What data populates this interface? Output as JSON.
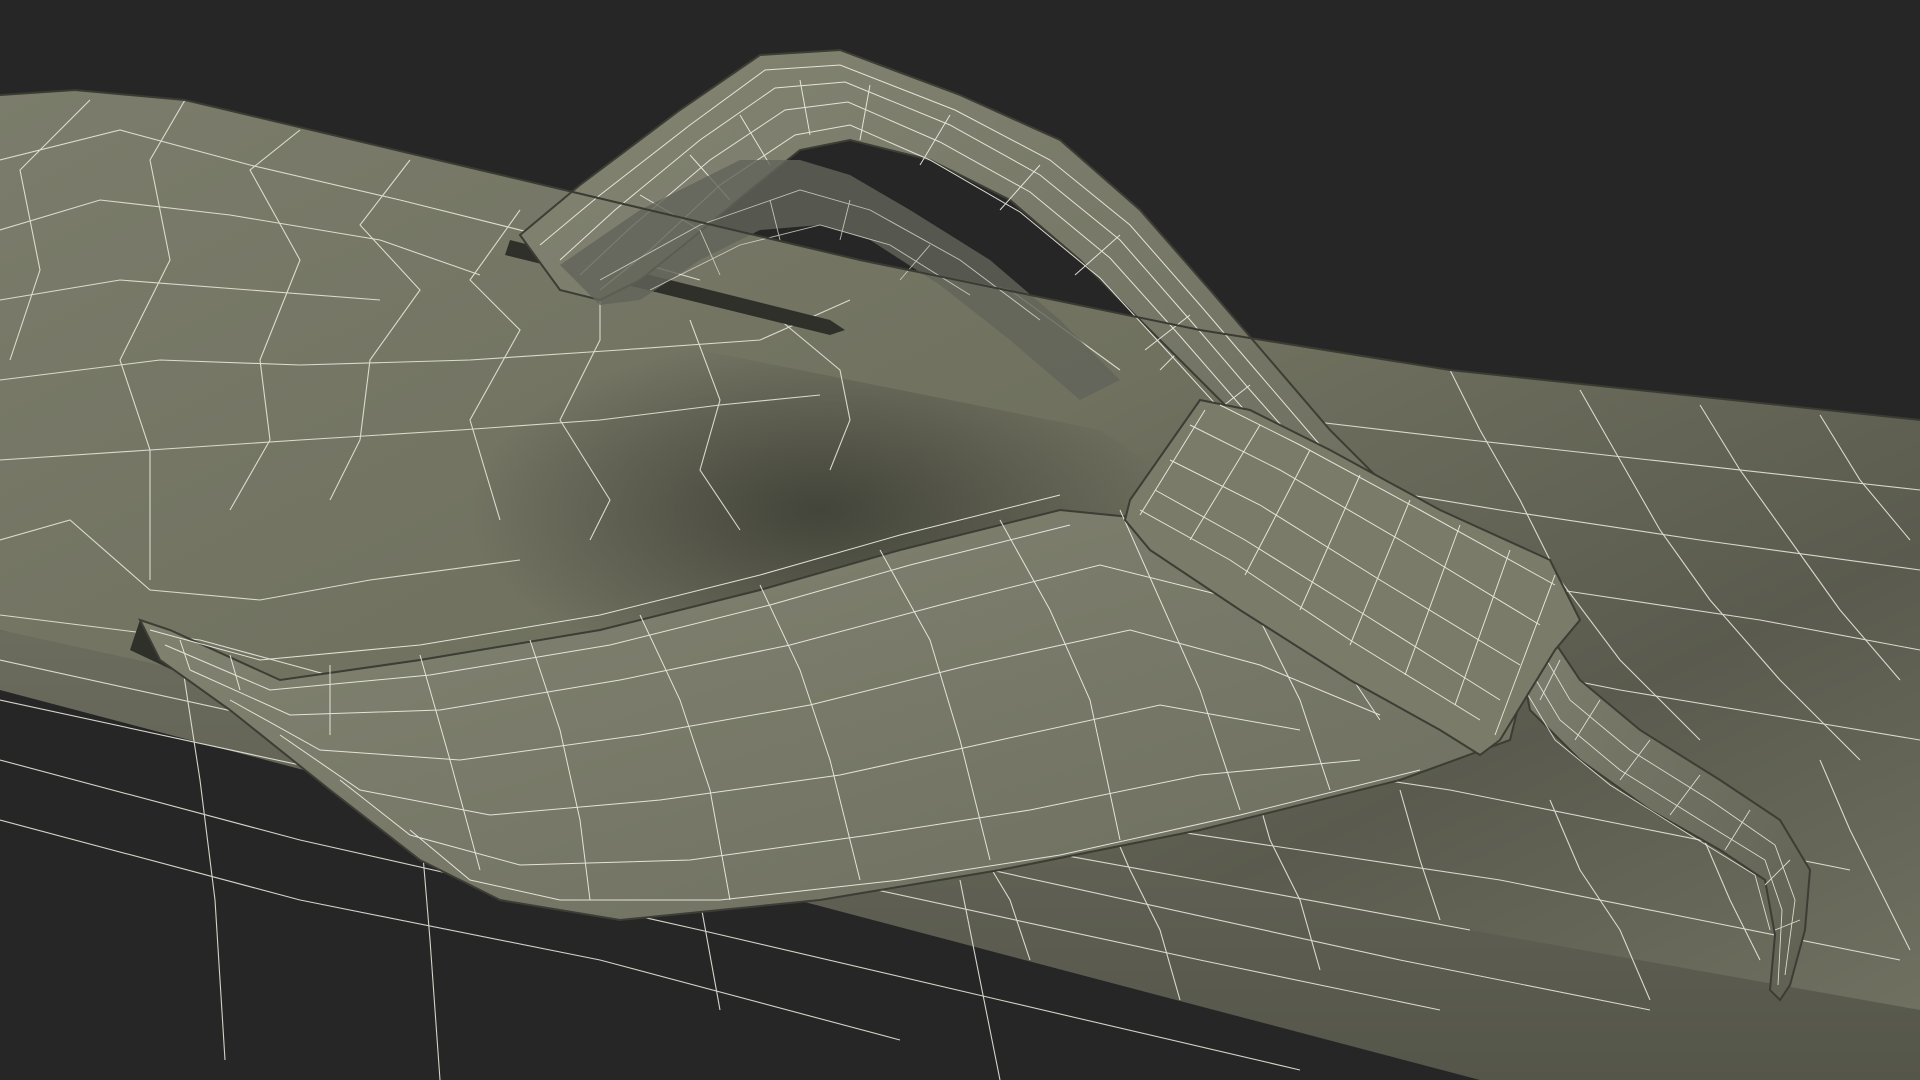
{
  "scene": {
    "subject": "flip-flop-sandal-wireframe",
    "render_style": "wireframe",
    "colors": {
      "background": "#262626",
      "surface_light": "#80816f",
      "surface_mid": "#6c6d5e",
      "surface_dark": "#4a4b41",
      "edge_dark": "#3c3d34",
      "wire": "#ecece0"
    }
  }
}
